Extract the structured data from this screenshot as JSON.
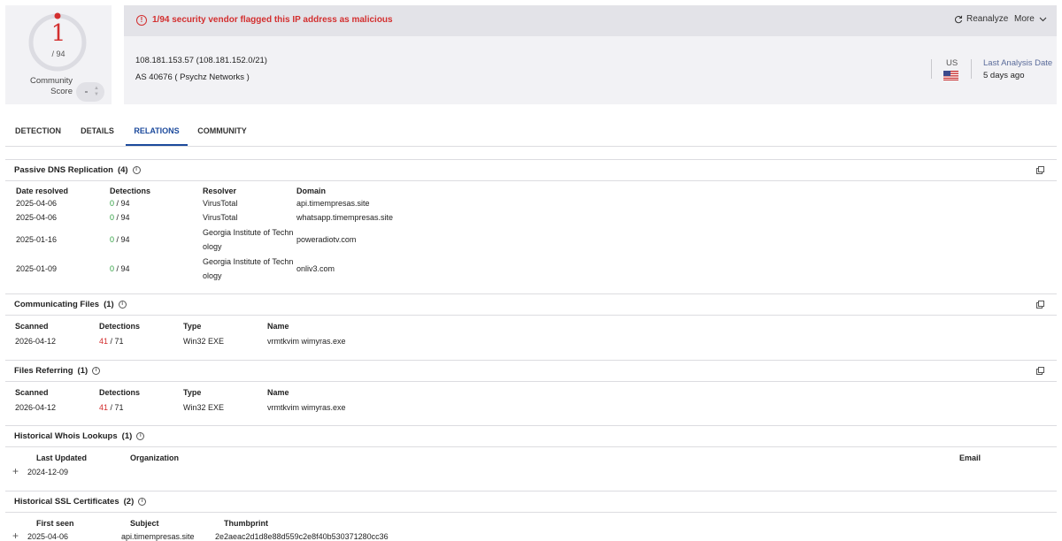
{
  "score": {
    "detected": "1",
    "total": "/ 94",
    "community_label": "Community Score"
  },
  "header": {
    "banner_text": "1/94 security vendor flagged this IP address as malicious",
    "reanalyze_label": "Reanalyze",
    "more_label": "More",
    "ip": "108.181.153.57  (108.181.152.0/21)",
    "as": "AS 40676  ( Psychz Networks )",
    "country": "US",
    "last_analysis_label": "Last Analysis Date",
    "last_analysis_value": "5 days ago"
  },
  "tabs": [
    "DETECTION",
    "DETAILS",
    "RELATIONS",
    "COMMUNITY"
  ],
  "passive_dns": {
    "title": "Passive DNS Replication",
    "count": "(4)",
    "headers": [
      "Date resolved",
      "Detections",
      "Resolver",
      "Domain"
    ],
    "rows": [
      {
        "date": "2025-04-06",
        "det_pos": "0",
        "det_tot": "/ 94",
        "resolver": "VirusTotal",
        "domain": "api.timempresas.site"
      },
      {
        "date": "2025-04-06",
        "det_pos": "0",
        "det_tot": "/ 94",
        "resolver": "VirusTotal",
        "domain": "whatsapp.timempresas.site"
      },
      {
        "date": "2025-01-16",
        "det_pos": "0",
        "det_tot": "/ 94",
        "resolver": "Georgia Institute of Technology",
        "domain": "poweradiotv.com"
      },
      {
        "date": "2025-01-09",
        "det_pos": "0",
        "det_tot": "/ 94",
        "resolver": "Georgia Institute of Technology",
        "domain": "onliv3.com"
      }
    ]
  },
  "communicating_files": {
    "title": "Communicating Files",
    "count": "(1)",
    "headers": [
      "Scanned",
      "Detections",
      "Type",
      "Name"
    ],
    "rows": [
      {
        "scanned": "2026-04-12",
        "det_pos": "41",
        "det_tot": "/ 71",
        "type": "Win32 EXE",
        "name": "vrmtkvim wimyras.exe"
      }
    ]
  },
  "files_referring": {
    "title": "Files Referring",
    "count": "(1)",
    "headers": [
      "Scanned",
      "Detections",
      "Type",
      "Name"
    ],
    "rows": [
      {
        "scanned": "2026-04-12",
        "det_pos": "41",
        "det_tot": "/ 71",
        "type": "Win32 EXE",
        "name": "vrmtkvim wimyras.exe"
      }
    ]
  },
  "whois": {
    "title": "Historical Whois Lookups",
    "count": "(1)",
    "headers": [
      "Last Updated",
      "Organization",
      "Email"
    ],
    "rows": [
      {
        "date": "2024-12-09"
      }
    ]
  },
  "ssl": {
    "title": "Historical SSL Certificates",
    "count": "(2)",
    "headers": [
      "First seen",
      "Subject",
      "Thumbprint"
    ],
    "rows": [
      {
        "date": "2025-04-06",
        "subject": "api.timempresas.site",
        "thumbprint": "2e2aeac2d1d8e88d559c2e8f40b530371280cc36"
      }
    ]
  },
  "colors": {
    "malicious": "#d32f2f",
    "clean": "#2e9e3f",
    "accent": "#1c4a9c"
  }
}
